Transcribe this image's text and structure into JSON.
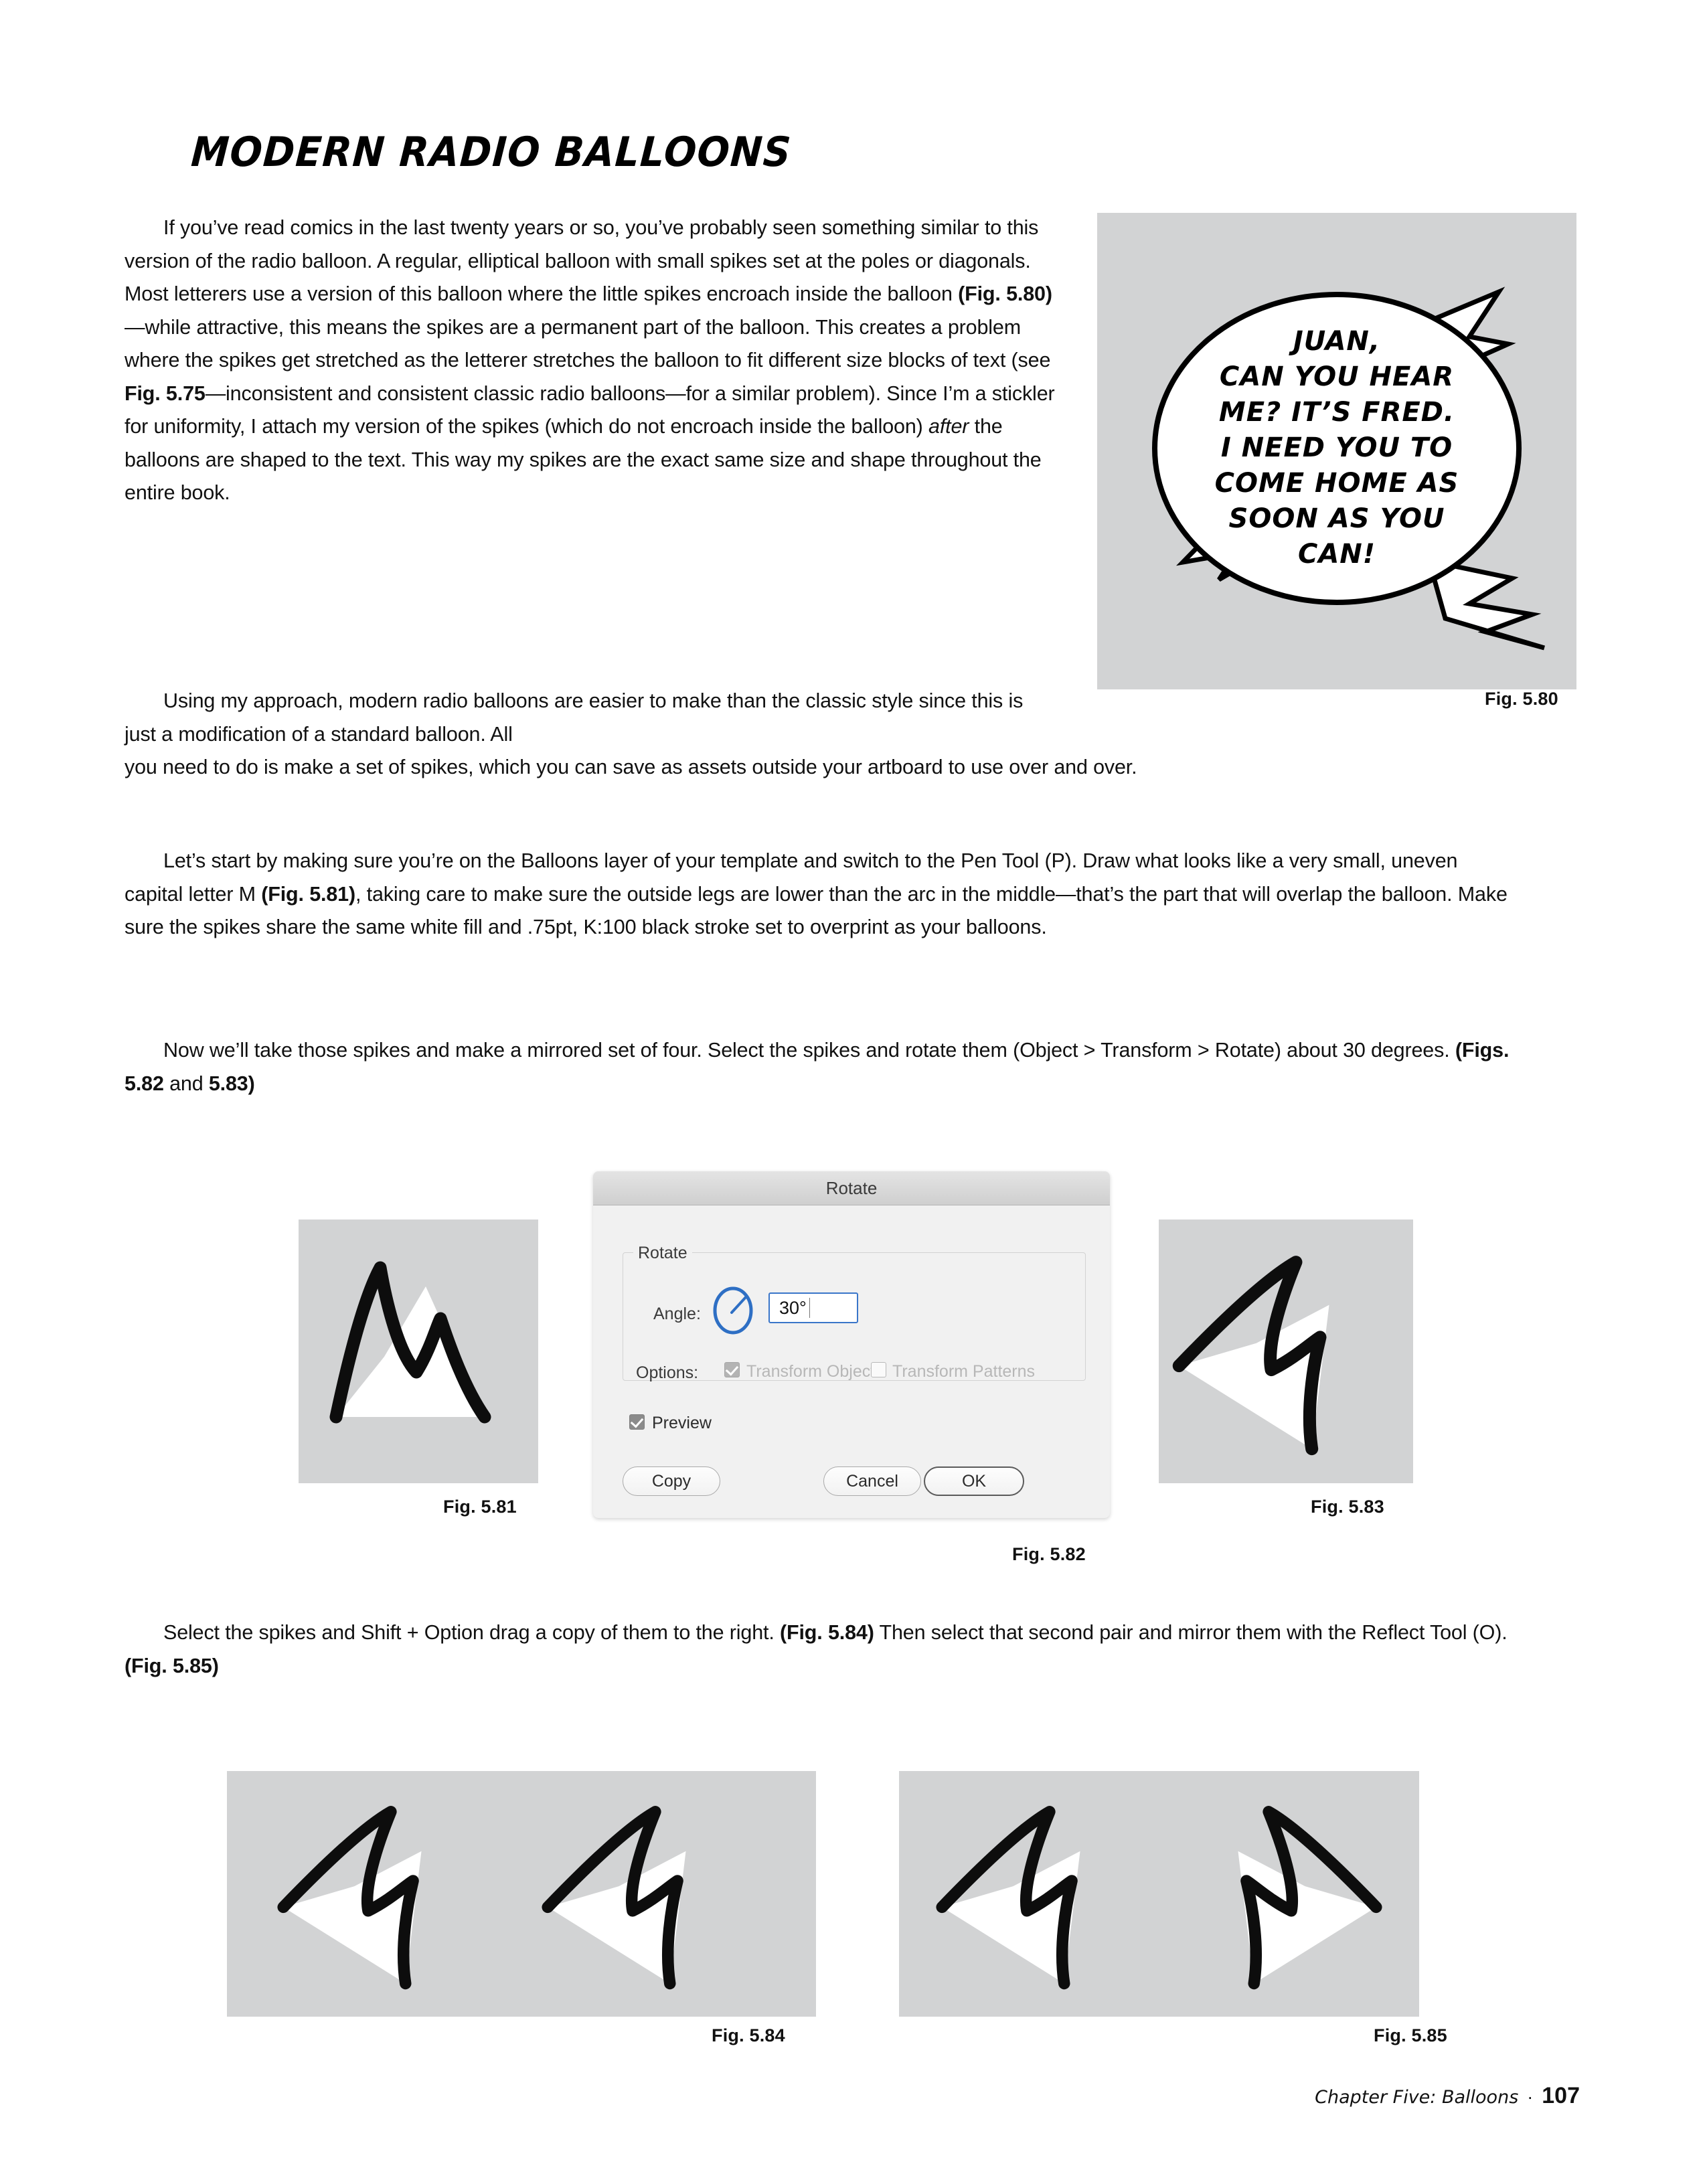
{
  "page": {
    "title": "MODERN RADIO BALLOONS",
    "background_color": "#ffffff",
    "figure_bg_color": "#d2d3d4"
  },
  "paragraphs": {
    "p1": "If you’ve read comics in the last twenty years or so, you’ve probably seen something similar to this version of the radio balloon. A regular, elliptical balloon with small spikes set at the poles or diagonals. Most letterers use a version of this balloon where the little spikes encroach inside the balloon (Fig. 5.80)—while attractive, this means the spikes are a permanent part of the balloon. This creates a problem where the spikes get stretched as the letterer stretches the balloon to fit different size blocks of text (see Fig. 5.75—inconsistent and consistent classic radio balloons—for a similar problem). Since I’m a stickler for uniformity, I attach my version of the spikes (which do not encroach inside the balloon) after the balloons are shaped to the text. This way my spikes are the exact same size and shape throughout the entire book.",
    "p2_narrow": "Using my approach, modern radio balloons are easier to make than the classic style since this is just a modification of a standard balloon. All",
    "p2_wide": "you need to do is make a set of spikes, which you can save as assets outside your artboard to use over and over.",
    "p3": "Let’s start by making sure you’re on the Balloons layer of your template and switch to the Pen Tool (P). Draw what looks like a very small, uneven capital letter M (Fig. 5.81), taking care to make sure the outside legs are lower than the arc in the middle—that’s the part that will overlap the balloon. Make sure the spikes share the same white fill and .75pt, K:100 black stroke set to overprint as your balloons.",
    "p4": "Now we’ll take those spikes and make a mirrored set of four. Select the spikes and rotate them (Object > Transform > Rotate) about 30 degrees. (Figs. 5.82 and 5.83)",
    "p5": "Select the spikes and Shift + Option drag a copy of them to the right. (Fig. 5.84) Then select that second pair and mirror them with the Reflect Tool (O). (Fig. 5.85)"
  },
  "balloon": {
    "lines": [
      "JUAN,",
      "CAN YOU HEAR",
      "ME? IT’S FRED.",
      "I NEED YOU TO",
      "COME HOME AS",
      "SOON AS YOU",
      "CAN!"
    ]
  },
  "figures": {
    "fig580": {
      "caption": "Fig. 5.80"
    },
    "fig581": {
      "caption": "Fig. 5.81"
    },
    "fig582": {
      "caption": "Fig. 5.82"
    },
    "fig583": {
      "caption": "Fig. 5.83"
    },
    "fig584": {
      "caption": "Fig. 5.84"
    },
    "fig585": {
      "caption": "Fig. 5.85"
    }
  },
  "rotate_dialog": {
    "title": "Rotate",
    "group_label": "Rotate",
    "angle_label": "Angle:",
    "angle_value": "30°",
    "options_label": "Options:",
    "transform_objects_label": "Transform Objects",
    "transform_objects_checked": true,
    "transform_patterns_label": "Transform Patterns",
    "transform_patterns_checked": false,
    "preview_label": "Preview",
    "preview_checked": true,
    "buttons": {
      "copy": "Copy",
      "cancel": "Cancel",
      "ok": "OK"
    },
    "accent_color": "#3a76c9"
  },
  "footer": {
    "chapter": "Chapter Five: Balloons",
    "separator": "·",
    "page_number": "107"
  }
}
